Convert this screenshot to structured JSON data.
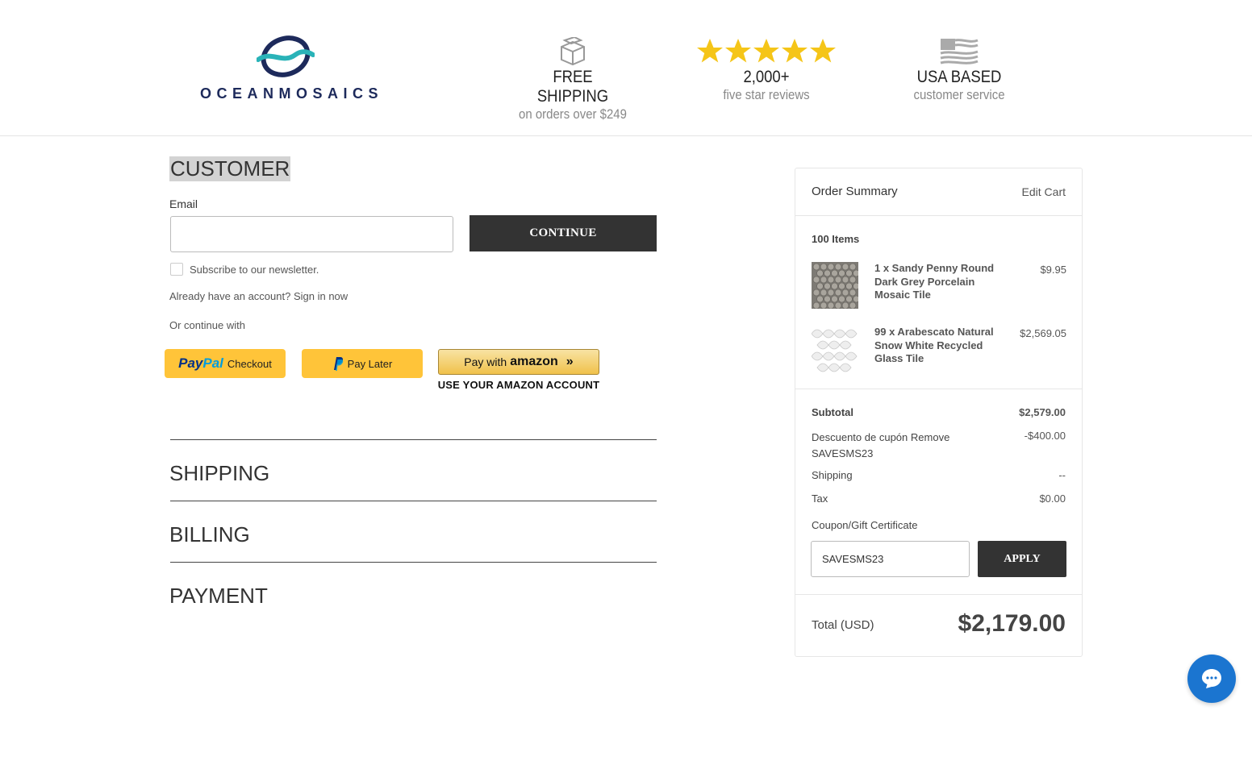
{
  "brand": {
    "name": "OCEANMOSAICS"
  },
  "badges": {
    "shipping": {
      "title": "FREE SHIPPING",
      "subtitle": "on orders over $249"
    },
    "reviews": {
      "title": "2,000+",
      "subtitle": "five star reviews"
    },
    "usa": {
      "title": "USA BASED",
      "subtitle": "customer service"
    }
  },
  "customer": {
    "title": "CUSTOMER",
    "email_label": "Email",
    "email_value": "",
    "continue_label": "CONTINUE",
    "newsletter_label": "Subscribe to our newsletter.",
    "newsletter_checked": false,
    "signin_prompt": "Already have an account?",
    "signin_link": "Sign in now",
    "or_continue": "Or continue with",
    "paypal": {
      "brand_a": "Pay",
      "brand_b": "Pal",
      "suffix": "Checkout"
    },
    "paylater": {
      "label": "Pay Later"
    },
    "amazon": {
      "prefix": "Pay with",
      "brand": "amazon",
      "sub": "USE YOUR AMAZON ACCOUNT"
    }
  },
  "sections": {
    "shipping": "SHIPPING",
    "billing": "BILLING",
    "payment": "PAYMENT"
  },
  "summary": {
    "title": "Order Summary",
    "edit_cart": "Edit Cart",
    "items_count": "100 Items",
    "items": [
      {
        "name": "1 x Sandy Penny Round Dark Grey Porcelain Mosaic Tile",
        "price": "$9.95"
      },
      {
        "name": "99 x Arabescato Natural Snow White Recycled Glass Tile",
        "price": "$2,569.05"
      }
    ],
    "subtotal_label": "Subtotal",
    "subtotal_value": "$2,579.00",
    "discount_label": "Descuento de cupón",
    "discount_remove": "Remove",
    "discount_code": "SAVESMS23",
    "discount_value": "-$400.00",
    "shipping_label": "Shipping",
    "shipping_value": "--",
    "tax_label": "Tax",
    "tax_value": "$0.00",
    "coupon_label": "Coupon/Gift Certificate",
    "coupon_value": "SAVESMS23",
    "apply_label": "APPLY",
    "total_label": "Total (USD)",
    "total_value": "$2,179.00"
  },
  "colors": {
    "dark_button": "#333333",
    "paypal_yellow": "#ffc439",
    "chat_blue": "#1b75d0",
    "star_gold": "#f5c518"
  }
}
